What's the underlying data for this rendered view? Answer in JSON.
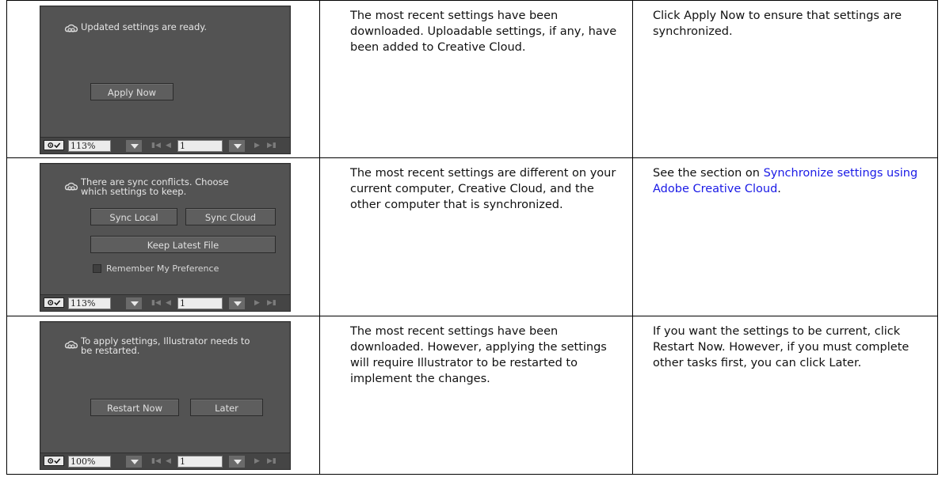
{
  "rows": [
    {
      "panel": {
        "message": "Updated settings are ready.",
        "buttons": [
          "Apply Now"
        ],
        "status_bar": {
          "zoom": "113%",
          "page": "1"
        }
      },
      "description": "The most recent settings have been downloaded. Uploadable settings, if any, have been added to Creative Cloud.",
      "action": "Click Apply Now to ensure that settings are synchronized."
    },
    {
      "panel": {
        "message_line1": "There are sync conflicts. Choose",
        "message_line2": "which settings to keep.",
        "buttons": [
          "Sync Local",
          "Sync Cloud",
          "Keep Latest File"
        ],
        "checkbox_label": "Remember My Preference",
        "status_bar": {
          "zoom": "113%",
          "page": "1"
        }
      },
      "description": "The most recent settings are different on your current computer, Creative Cloud, and the other computer that is synchronized.",
      "action_prefix": "See the section on ",
      "action_link": "Synchronize settings using Adobe Creative Cloud",
      "action_suffix": "."
    },
    {
      "panel": {
        "message_line1": "To apply settings, Illustrator needs to",
        "message_line2": "be restarted.",
        "buttons": [
          "Restart Now",
          "Later"
        ],
        "status_bar": {
          "zoom": "100%",
          "page": "1"
        }
      },
      "description": "The most recent settings have been downloaded. However, applying the settings will require Illustrator to be restarted to implement the changes.",
      "action": "If you want the settings to be current, click Restart Now. However, if you must complete other tasks first, you can click Later."
    }
  ],
  "icons": {
    "creative_cloud": "creative-cloud-icon",
    "settings_toggle": "gear-check-icon",
    "dropdown": "chevron-down-icon",
    "nav_first": "first-page-icon",
    "nav_prev": "previous-page-icon",
    "nav_next": "next-page-icon",
    "nav_last": "last-page-icon"
  },
  "colors": {
    "panel_background": "#535353",
    "panel_border": "#2e2e2e",
    "button_background": "#5e5e5e",
    "panel_text": "#e6e6e6",
    "link": "#1a1ae6"
  }
}
